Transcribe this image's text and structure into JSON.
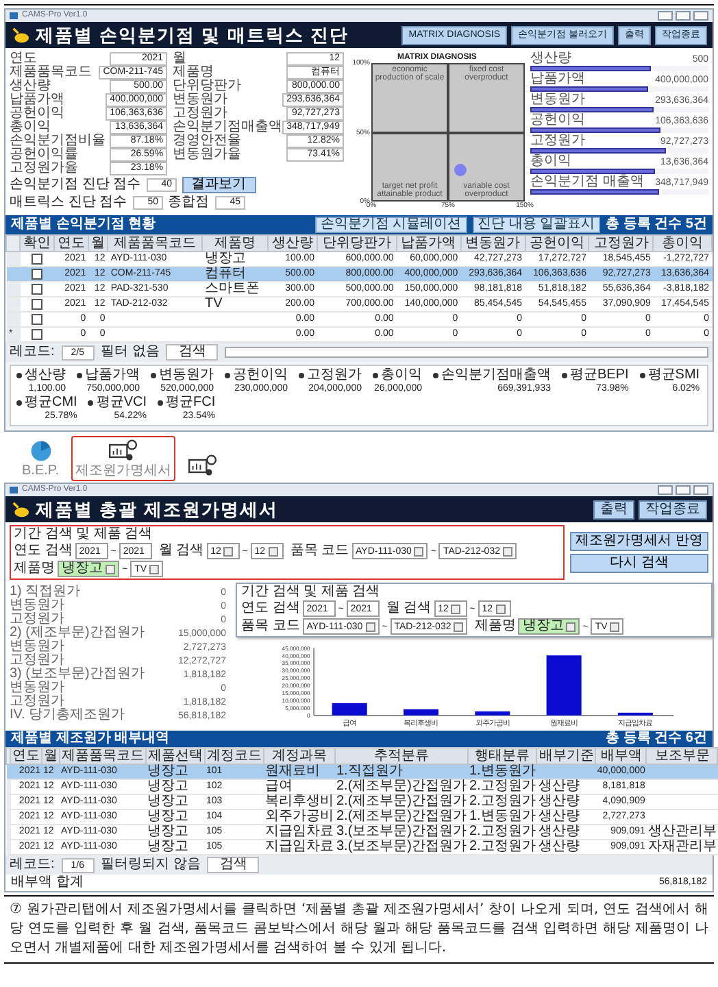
{
  "window1": {
    "title_bar": "CAMS-Pro Ver1.0",
    "heading": "제품별 손익분기점 및 매트릭스 진단",
    "buttons": [
      "MATRIX DIAGNOSIS",
      "손익분기점 불러오기",
      "출력",
      "작업종료"
    ],
    "fields": [
      {
        "label": "연도",
        "value": "2021"
      },
      {
        "label": "월",
        "value": "12"
      },
      {
        "label": "제품품목코드",
        "value": "COM-211-745"
      },
      {
        "label": "제품명",
        "value": "컴퓨터"
      },
      {
        "label": "생산량",
        "value": "500.00"
      },
      {
        "label": "단위당판가",
        "value": "800,000.00"
      },
      {
        "label": "납품가액",
        "value": "400,000,000"
      },
      {
        "label": "변동원가",
        "value": "293,636,364"
      },
      {
        "label": "공헌이익",
        "value": "106,363,636"
      },
      {
        "label": "고정원가",
        "value": "92,727,273"
      },
      {
        "label": "총이익",
        "value": "13,636,364"
      },
      {
        "label": "손익분기점매출액",
        "value": "348,717,949"
      },
      {
        "label": "손익분기점비율",
        "value": "87.18%"
      },
      {
        "label": "경영안전율",
        "value": "12.82%"
      },
      {
        "label": "공헌이익률",
        "value": "26.59%"
      },
      {
        "label": "변동원가율",
        "value": "73.41%"
      },
      {
        "label": "고정원가율",
        "value": "23.18%"
      }
    ],
    "bep_score": {
      "label": "손익분기점 진단 점수",
      "value": "40",
      "button": "결과보기"
    },
    "matrix_score": {
      "label": "매트릭스 진단 점수",
      "value": "50",
      "total_label": "종합점",
      "total_value": "45"
    },
    "matrix": {
      "chart_data": {
        "type": "scatter",
        "title": "MATRIX DIAGNOSIS",
        "x": [
          87.18
        ],
        "series": [
          {
            "color": "#8080f0",
            "values": [
              23
            ]
          }
        ],
        "xlim": [
          0,
          150
        ],
        "ylim": [
          0,
          100
        ],
        "xticks": [
          {
            "value": 0,
            "label": "0%"
          },
          {
            "value": 75,
            "label": "75%"
          },
          {
            "value": 150,
            "label": "150%"
          }
        ],
        "yticks": [
          {
            "value": 0,
            "label": "0%"
          },
          {
            "value": 50,
            "label": "50%"
          },
          {
            "value": 100,
            "label": "100%"
          }
        ],
        "annotations": [
          "economic production of scale",
          "fixed cost overproduct",
          "target net profit attainable product",
          "variable cost overproduct"
        ]
      }
    },
    "bars": [
      {
        "label": "생산량",
        "value": "500",
        "level": 0.68
      },
      {
        "label": "납품가액",
        "value": "400,000,000",
        "level": 0.66
      },
      {
        "label": "변동원가",
        "value": "293,636,364",
        "level": 0.69
      },
      {
        "label": "공헌이익",
        "value": "106,363,636",
        "level": 0.73
      },
      {
        "label": "고정원가",
        "value": "92,727,273",
        "level": 0.76
      },
      {
        "label": "총이익",
        "value": "13,636,364",
        "level": 0.7
      },
      {
        "label": "손익분기점 매출액",
        "value": "348,717,949",
        "level": 0.72
      }
    ],
    "table": {
      "title": "제품별 손익분기점 현황",
      "buttons": [
        "손익분기점 시뮬레이션",
        "진단 내용 일괄표시"
      ],
      "count": "총 등록 건수 5건",
      "check_column": "확인",
      "columns": [
        "연도",
        "월",
        "제품품목코드",
        "제품명",
        "생산량",
        "단위당판가",
        "납품가액",
        "변동원가",
        "공헌이익",
        "고정원가",
        "총이익"
      ],
      "rows": [
        {
          "checked": false,
          "selected": false,
          "cells": [
            "2021",
            "12",
            "AYD-111-030",
            "냉장고",
            "100.00",
            "600,000.00",
            "60,000,000",
            "42,727,273",
            "17,272,727",
            "18,545,455",
            "-1,272,727"
          ]
        },
        {
          "checked": false,
          "selected": true,
          "cells": [
            "2021",
            "12",
            "COM-211-745",
            "컴퓨터",
            "500.00",
            "800,000.00",
            "400,000,000",
            "293,636,364",
            "106,363,636",
            "92,727,273",
            "13,636,364"
          ]
        },
        {
          "checked": false,
          "selected": false,
          "cells": [
            "2021",
            "12",
            "PAD-321-530",
            "스마트폰",
            "300.00",
            "500,000.00",
            "150,000,000",
            "98,181,818",
            "51,818,182",
            "55,636,364",
            "-3,818,182"
          ]
        },
        {
          "checked": false,
          "selected": false,
          "cells": [
            "2021",
            "12",
            "TAD-212-032",
            "TV",
            "200.00",
            "700,000.00",
            "140,000,000",
            "85,454,545",
            "54,545,455",
            "37,090,909",
            "17,454,545"
          ]
        },
        {
          "checked": false,
          "selected": false,
          "cells": [
            "0",
            "0",
            null,
            null,
            "0.00",
            "0.00",
            "0",
            "0",
            "0",
            "0",
            "0"
          ]
        },
        {
          "checked": false,
          "selected": false,
          "marker": "*",
          "cells": [
            "0",
            "0",
            null,
            null,
            "0.00",
            "0.00",
            "0",
            "0",
            "0",
            "0",
            "0"
          ]
        }
      ]
    },
    "navigator": {
      "label": "레코드:",
      "position": "2/5",
      "filter": "필터 없음",
      "search": "검색"
    },
    "summary": [
      {
        "label": "생산량",
        "value": "1,100.00"
      },
      {
        "label": "납품가액",
        "value": "750,000,000"
      },
      {
        "label": "변동원가",
        "value": "520,000,000"
      },
      {
        "label": "공헌이익",
        "value": "230,000,000"
      },
      {
        "label": "고정원가",
        "value": "204,000,000"
      },
      {
        "label": "총이익",
        "value": "26,000,000"
      },
      {
        "label": "손익분기점매출액",
        "value": "669,391,933"
      },
      {
        "label": "평균BEPI",
        "value": "73.98%"
      },
      {
        "label": "평균SMI",
        "value": "6.02%"
      },
      {
        "label": "평균CMI",
        "value": "25.78%"
      },
      {
        "label": "평균VCI",
        "value": "54.22%"
      },
      {
        "label": "평균FCI",
        "value": "23.54%"
      }
    ]
  },
  "launcher": [
    {
      "kind": "pie",
      "label": "B.E.P.",
      "selected": false
    },
    {
      "kind": "report",
      "label": "제조원가명세서",
      "selected": true
    },
    {
      "kind": "report",
      "selected": false
    }
  ],
  "window2": {
    "title_bar": "CAMS-Pro Ver1.0",
    "heading": "제품별 총괄 제조원가명세서",
    "buttons": [
      "출력",
      "작업종료"
    ],
    "search": {
      "title": "기간 검색 및 제품 검색",
      "separator": "~",
      "groups": [
        {
          "label": "연도 검색",
          "from": "2021",
          "to": "2021",
          "kind": "text"
        },
        {
          "label": "월 검색",
          "from": "12",
          "to": "12",
          "kind": "combo"
        },
        {
          "label": "품목 코드",
          "from": "AYD-111-030",
          "to": "TAD-212-032",
          "kind": "combo"
        },
        {
          "label": "제품명",
          "from": "냉장고",
          "to": "TV",
          "kind": "combo"
        }
      ]
    },
    "search_buttons": [
      "제조원가명세서 반영",
      "다시 검색"
    ],
    "callout": {
      "title": "기간 검색 및 제품 검색",
      "separator": "~",
      "groups": [
        {
          "label": "연도 검색",
          "from": "2021",
          "to": "2021",
          "kind": "text"
        },
        {
          "label": "월 검색",
          "from": "12",
          "to": "12",
          "kind": "combo"
        },
        {
          "label": "품목 코드",
          "from": "AYD-111-030",
          "to": "TAD-212-032",
          "kind": "combo"
        },
        {
          "label": "제품명",
          "from": "냉장고",
          "to": "TV",
          "kind": "combo"
        }
      ]
    },
    "statement": [
      {
        "label": "1) 직접원가",
        "value": "0"
      },
      {
        "label": "변동원가",
        "value": "0"
      },
      {
        "label": "고정원가",
        "value": "0"
      },
      {
        "label": "2) (제조부문)간접원가",
        "value": "15,000,000"
      },
      {
        "label": "변동원가",
        "value": "2,727,273"
      },
      {
        "label": "고정원가",
        "value": "12,272,727"
      },
      {
        "label": "3) (보조부문)간접원가",
        "value": "1,818,182"
      },
      {
        "label": "변동원가",
        "value": "0"
      },
      {
        "label": "고정원가",
        "value": "1,818,182"
      },
      {
        "label": "IV. 당기총제조원가",
        "value": "56,818,182"
      }
    ],
    "chart": {
      "chart_data": {
        "type": "bar",
        "categories": [
          "급여",
          "복리후생비",
          "외주가공비",
          "원재료비",
          "지급임차료"
        ],
        "series": [
          {
            "color": "#0a0ad0",
            "values": [
              8200000,
              4100000,
              2700000,
              40000000,
              1800000
            ]
          }
        ],
        "ylim": [
          0,
          45000000
        ],
        "yticks": [
          {
            "value": 0,
            "label": "0"
          },
          {
            "value": 5000000,
            "label": "5,000,000"
          },
          {
            "value": 10000000,
            "label": "10,000,000"
          },
          {
            "value": 15000000,
            "label": "15,000,000"
          },
          {
            "value": 20000000,
            "label": "20,000,000"
          },
          {
            "value": 25000000,
            "label": "25,000,000"
          },
          {
            "value": 30000000,
            "label": "30,000,000"
          },
          {
            "value": 35000000,
            "label": "35,000,000"
          },
          {
            "value": 40000000,
            "label": "40,000,000"
          },
          {
            "value": 45000000,
            "label": "45,000,000"
          }
        ]
      }
    },
    "table": {
      "title": "제품별 제조원가 배부내역",
      "count": "총 등록 건수 6건",
      "columns": [
        "연도",
        "월",
        "제품품목코드",
        "제품선택",
        "계정코드",
        "계정과목",
        "추적분류",
        "행태분류",
        "배부기준",
        "배부액",
        "보조부문"
      ],
      "rows": [
        {
          "selected": true,
          "cells": [
            "2021",
            "12",
            "AYD-111-030",
            "냉장고",
            "101",
            "원재료비",
            "1.직접원가",
            "1.변동원가",
            null,
            "40,000,000",
            null
          ]
        },
        {
          "selected": false,
          "cells": [
            "2021",
            "12",
            "AYD-111-030",
            "냉장고",
            "102",
            "급여",
            "2.(제조부문)간접원가",
            "2.고정원가",
            "생산량",
            "8,181,818",
            null
          ]
        },
        {
          "selected": false,
          "cells": [
            "2021",
            "12",
            "AYD-111-030",
            "냉장고",
            "103",
            "복리후생비",
            "2.(제조부문)간접원가",
            "2.고정원가",
            "생산량",
            "4,090,909",
            null
          ]
        },
        {
          "selected": false,
          "cells": [
            "2021",
            "12",
            "AYD-111-030",
            "냉장고",
            "104",
            "외주가공비",
            "2.(제조부문)간접원가",
            "1.변동원가",
            "생산량",
            "2,727,273",
            null
          ]
        },
        {
          "selected": false,
          "cells": [
            "2021",
            "12",
            "AYD-111-030",
            "냉장고",
            "105",
            "지급임차료",
            "3.(보조부문)간접원가",
            "2.고정원가",
            "생산량",
            "909,091",
            "생산관리부"
          ]
        },
        {
          "selected": false,
          "cells": [
            "2021",
            "12",
            "AYD-111-030",
            "냉장고",
            "105",
            "지급임차료",
            "3.(보조부문)간접원가",
            "2.고정원가",
            "생산량",
            "909,091",
            "자재관리부"
          ]
        }
      ]
    },
    "navigator": {
      "label": "레코드:",
      "position": "1/6",
      "filter": "필터링되지 않음",
      "search": "검색"
    },
    "total": {
      "label": "배부액 합계",
      "value": "56,818,182"
    }
  },
  "note": {
    "marker": "⑦",
    "text": "원가관리탭에서 제조원가명세서를 클릭하면 ‘제품별 총괄 제조원가명세서’ 창이 나오게 되며, 연도 검색에서 해당 연도를 입력한 후 월 검색, 품목코드 콤보박스에서 해당 월과 해당 품목코드를 검색 입력하면 해당 제품명이 나오면서 개별제품에 대한 제조원가명세서를 검색하여 볼 수 있게 됩니다."
  }
}
